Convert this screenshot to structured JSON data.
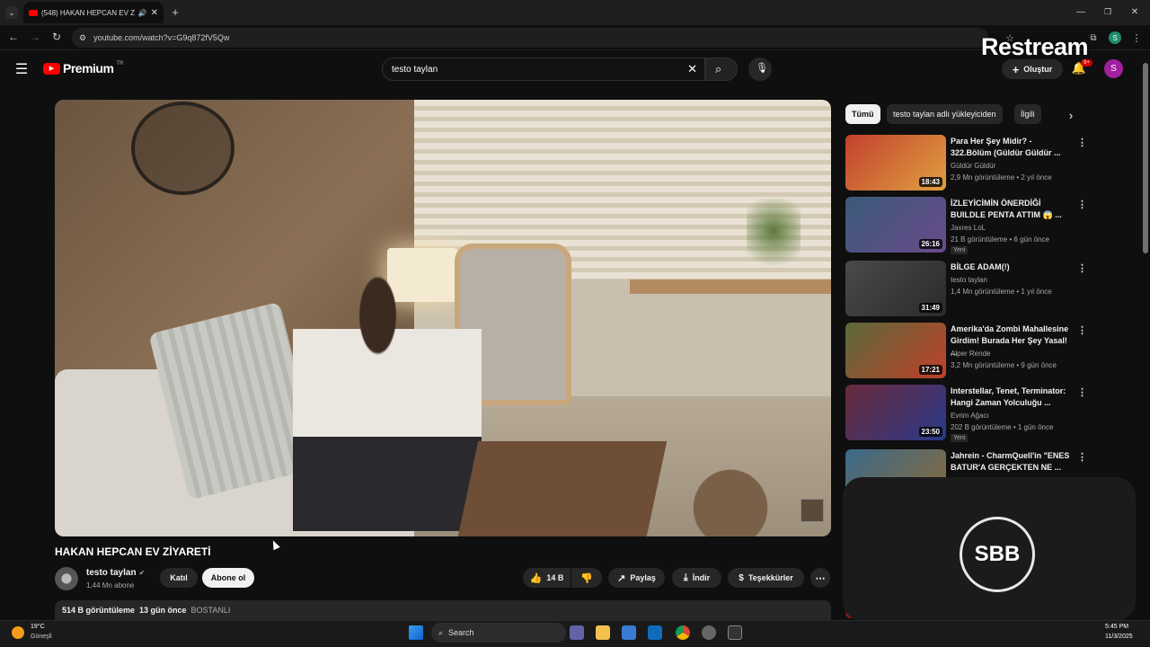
{
  "browser": {
    "tab_title": "(548) HAKAN HEPCAN EV Z",
    "url": "youtube.com/watch?v=G9q872fV5Qw",
    "profile_initial": "S"
  },
  "header": {
    "logo_text": "Premium",
    "logo_sup": "TR",
    "search_value": "testo taylan",
    "create_label": "Oluştur",
    "notif_count": "9+",
    "avatar_initial": "S",
    "watermark": "Restream"
  },
  "video": {
    "title": "HAKAN HEPCAN EV ZİYARETİ",
    "channel": "testo taylan",
    "subscribers": "1,44 Mn abone",
    "join_label": "Katıl",
    "subscribe_label": "Abone ol",
    "likes": "14 B",
    "share_label": "Paylaş",
    "download_label": "İndir",
    "thanks_label": "Teşekkürler",
    "views": "514 B görüntüleme",
    "age": "13 gün önce",
    "tag": "BOSTANLI"
  },
  "chips": [
    "Tümü",
    "testo taylan adlı yükleyiciden",
    "İlgili"
  ],
  "recommendations": [
    {
      "title": "Para Her Şey Midir? - 322.Bölüm (Güldür Güldür ...",
      "channel": "Güldür Güldür",
      "meta": "2,9 Mn görüntüleme • 2 yıl önce",
      "duration": "18:43",
      "new": "",
      "thumb_color": "#c2402e"
    },
    {
      "title": "İZLEYİCİMİN ÖNERDİĞİ BUILDLE PENTA ATTIM 😱 ...",
      "channel": "Jaxres LoL",
      "meta": "21 B görüntüleme • 6 gün önce",
      "duration": "26:16",
      "new": "Yeni",
      "thumb_color": "#3a5a7a"
    },
    {
      "title": "BİLGE ADAM(!)",
      "channel": "testo taylan",
      "meta": "1,4 Mn görüntüleme • 1 yıl önce",
      "duration": "31:49",
      "new": "",
      "thumb_color": "#4a4a4a"
    },
    {
      "title": "Amerika'da Zombi Mahallesine Girdim! Burada Her Şey Yasal! ...",
      "channel": "Alper Rende",
      "meta": "3,2 Mn görüntüleme • 9 gün önce",
      "duration": "17:21",
      "new": "",
      "thumb_color": "#5a6a3a"
    },
    {
      "title": "Interstellar, Tenet, Terminator: Hangi Zaman Yolculuğu ...",
      "channel": "Evrim Ağacı",
      "meta": "202 B görüntüleme • 1 gün önce",
      "duration": "23:50",
      "new": "Yeni",
      "thumb_color": "#6a2a3a"
    },
    {
      "title": "Jahrein - CharmQuell'in \"ENES BATUR'A GERÇEKTEN NE ...",
      "channel": "",
      "meta": "",
      "duration": "",
      "new": "",
      "thumb_color": "#3a6a8a"
    }
  ],
  "overlay": {
    "logo_text": "SBB"
  },
  "taskbar": {
    "weather_temp": "19°C",
    "weather_desc": "Güneşli",
    "search_label": "Search",
    "time": "5:45 PM",
    "date": "11/3/2025"
  }
}
